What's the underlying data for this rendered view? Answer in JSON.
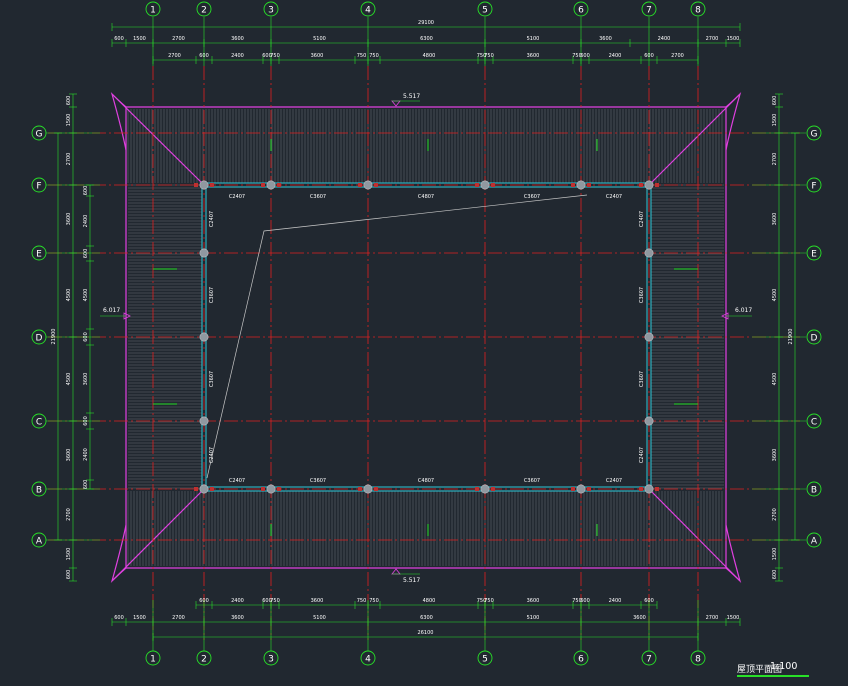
{
  "drawing": {
    "grid_axes_x": [
      "1",
      "2",
      "3",
      "4",
      "5",
      "6",
      "7",
      "8"
    ],
    "grid_axes_y": [
      "G",
      "F",
      "E",
      "D",
      "C",
      "B",
      "A"
    ],
    "overall_width": "29100",
    "overall_width_bottom": "26100",
    "overall_depth": "21900",
    "top_dims_row1": [
      "600",
      "1500",
      "2700",
      "3600",
      "5100",
      "6300",
      "5100",
      "3600",
      "2400",
      "2700",
      "1500",
      "600"
    ],
    "top_dims_row2": [
      "2700",
      "600",
      "2400",
      "600",
      "750",
      "3600",
      "750",
      "750",
      "4800",
      "750",
      "750",
      "3600",
      "750",
      "600",
      "2400",
      "600",
      "2700"
    ],
    "bottom_dims_row1": [
      "600",
      "2400",
      "600",
      "750",
      "3600",
      "750",
      "750",
      "4800",
      "750",
      "750",
      "3600",
      "750",
      "600",
      "2400",
      "600"
    ],
    "bottom_dims_row2": [
      "600",
      "1500",
      "2700",
      "3600",
      "5100",
      "6300",
      "5100",
      "3600",
      "2700",
      "1500",
      "600"
    ],
    "left_dims_outer": [
      "600",
      "1500",
      "2700",
      "3600",
      "4500",
      "4500",
      "3600",
      "2700",
      "1500",
      "600"
    ],
    "left_dims_inner": [
      "600",
      "2400",
      "600",
      "4500",
      "600",
      "3600",
      "600",
      "2400",
      "600"
    ],
    "right_dims": [
      "600",
      "1500",
      "2700",
      "3600",
      "4500",
      "4500",
      "3600",
      "2700",
      "1500",
      "600"
    ],
    "level_marks": [
      "5.517",
      "5.517",
      "6.017",
      "6.017"
    ],
    "beam_labels_top": [
      "C2407",
      "C3607",
      "C4807",
      "C3607",
      "C2407"
    ],
    "beam_labels_bottom": [
      "C2407",
      "C3607",
      "C4807",
      "C3607",
      "C2407"
    ],
    "beam_labels_left": [
      "C2407",
      "C3607",
      "C3607",
      "C2407"
    ],
    "beam_labels_right": [
      "C2407",
      "C3607",
      "C3607",
      "C2407"
    ],
    "caption": "屋顶平面图",
    "scale": "1:100"
  },
  "colors": {
    "background": "#212830",
    "roof_outline": "#e040e0",
    "axis_line": "#e02020",
    "dimension": "#28e028",
    "beam": "#2ec8d8",
    "hatch": "#9aa0a8",
    "column": "#9098a0",
    "text": "#ffffff"
  }
}
